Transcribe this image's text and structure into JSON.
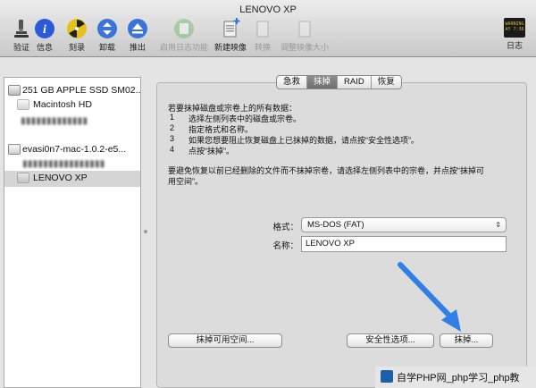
{
  "window": {
    "title": "LENOVO XP"
  },
  "toolbar": {
    "items": [
      {
        "label": "验证",
        "icon": "microscope-icon",
        "enabled": true
      },
      {
        "label": "信息",
        "icon": "info-icon",
        "enabled": true
      },
      {
        "label": "刻录",
        "icon": "burn-icon",
        "enabled": true
      },
      {
        "label": "卸载",
        "icon": "unmount-icon",
        "enabled": true
      },
      {
        "label": "推出",
        "icon": "eject-icon",
        "enabled": true
      },
      {
        "label": "启用日志功能",
        "icon": "journal-icon",
        "enabled": false
      },
      {
        "label": "新建映像",
        "icon": "new-image-icon",
        "enabled": true
      },
      {
        "label": "转换",
        "icon": "convert-icon",
        "enabled": false
      },
      {
        "label": "调整映像大小",
        "icon": "resize-image-icon",
        "enabled": false
      },
      {
        "label": "日志",
        "icon": "log-icon",
        "enabled": true
      }
    ],
    "log_icon_text": "WARNING\nAY 7:36"
  },
  "sidebar": {
    "items": [
      {
        "label": "251 GB APPLE SSD SM02...",
        "level": 0,
        "blurred": false
      },
      {
        "label": "Macintosh HD",
        "level": 1,
        "blurred": false
      },
      {
        "label": "evasi0n7-mac-1.0.2-e5...",
        "level": 0,
        "blurred": false
      },
      {
        "label": "LENOVO XP",
        "level": 1,
        "blurred": false,
        "selected": true
      }
    ]
  },
  "tabs": [
    "急救",
    "抹掉",
    "RAID",
    "恢复"
  ],
  "active_tab": "抹掉",
  "erase": {
    "intro": "若要抹掉磁盘或宗卷上的所有数据：",
    "steps": [
      {
        "n": "1",
        "text": "选择左侧列表中的磁盘或宗卷。"
      },
      {
        "n": "2",
        "text": "指定格式和名称。"
      },
      {
        "n": "3",
        "text": "如果您想要阻止恢复磁盘上已抹掉的数据，请点按“安全性选项”。"
      },
      {
        "n": "4",
        "text": "点按“抹掉”。"
      }
    ],
    "note_line1": "要避免恢复以前已经删除的文件而不抹掉宗卷，请选择左侧列表中的宗卷，并点按“抹掉可",
    "note_line2": "用空间”。",
    "format_label": "格式：",
    "format_value": "MS-DOS (FAT)",
    "name_label": "名称：",
    "name_value": "LENOVO XP",
    "btn_erase_free": "抹掉可用空间...",
    "btn_security": "安全性选项...",
    "btn_erase": "抹掉..."
  },
  "watermark": {
    "text": "自学PHP网_php学习_php教"
  },
  "colors": {
    "arrow": "#2f7fe6",
    "info": "#2b5ad8",
    "burn": "#e5c21b"
  }
}
